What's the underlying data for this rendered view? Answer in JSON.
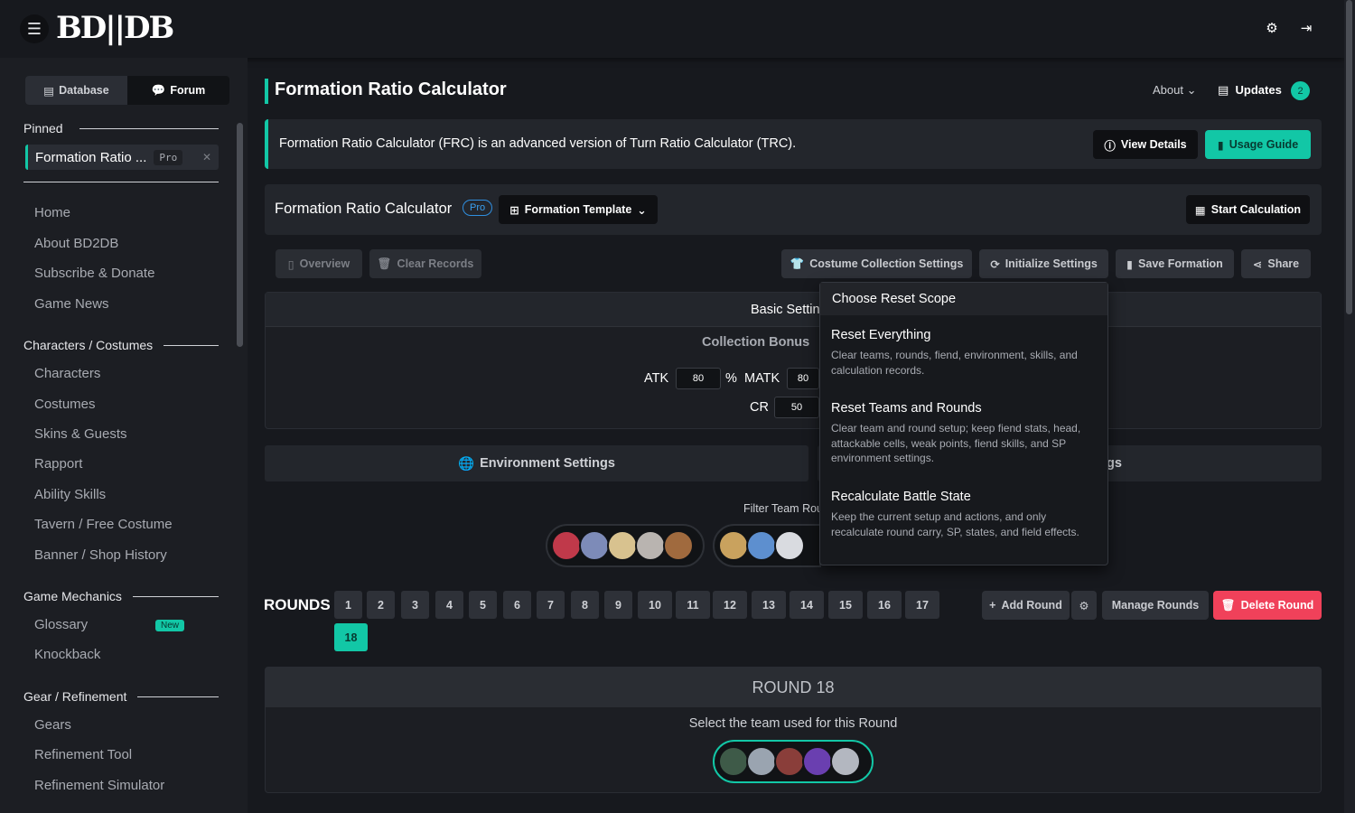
{
  "header": {
    "logo": "BD||DB",
    "menu_icon": "hamburger-icon",
    "settings_icon": "gear-icon",
    "login_icon": "sign-in-icon"
  },
  "sidebar": {
    "tabs": [
      {
        "label": "Database",
        "icon": "database-icon"
      },
      {
        "label": "Forum",
        "icon": "comments-icon"
      }
    ],
    "pinned_title": "Pinned",
    "pinned_item": {
      "label": "Formation Ratio ...",
      "badge": "Pro"
    },
    "items_top": [
      "Home",
      "About BD2DB",
      "Subscribe & Donate",
      "Game News"
    ],
    "sections": [
      {
        "title": "Characters / Costumes",
        "items": [
          "Characters",
          "Costumes",
          "Skins & Guests",
          "Rapport",
          "Ability Skills",
          "Tavern / Free Costume",
          "Banner / Shop History"
        ]
      },
      {
        "title": "Game Mechanics",
        "items": [
          "Glossary",
          "Knockback"
        ],
        "badge": "New"
      },
      {
        "title": "Gear / Refinement",
        "items": [
          "Gears",
          "Refinement Tool",
          "Refinement Simulator"
        ]
      }
    ]
  },
  "page": {
    "title": "Formation Ratio Calculator",
    "about": "About",
    "updates": "Updates",
    "updates_count": "2",
    "banner_text": "Formation Ratio Calculator (FRC) is an advanced version of Turn Ratio Calculator (TRC).",
    "view_details": "View Details",
    "usage_guide": "Usage Guide"
  },
  "calc": {
    "title": "Formation Ratio Calculator",
    "badge": "Pro",
    "template": "Formation Template",
    "start": "Start Calculation",
    "overview": "Overview",
    "clear": "Clear Records",
    "costume": "Costume Collection Settings",
    "init": "Initialize Settings",
    "save": "Save Formation",
    "share": "Share"
  },
  "basic": {
    "header": "Basic Settin",
    "collection": "Collection Bonus",
    "atk_label": "ATK",
    "atk": "80",
    "pct": "%",
    "matk_label": "MATK",
    "matk": "80",
    "cr_label": "CR",
    "cr": "50"
  },
  "env": {
    "left": "Environment Settings",
    "right_fragment": "gs"
  },
  "filter_label": "Filter Team Rou",
  "rounds": {
    "label": "ROUNDS",
    "numbers": [
      "1",
      "2",
      "3",
      "4",
      "5",
      "6",
      "7",
      "8",
      "9",
      "10",
      "11",
      "12",
      "13",
      "14",
      "15",
      "16",
      "17",
      "18"
    ],
    "selected": "18",
    "add": "Add Round",
    "manage": "Manage Rounds",
    "delete": "Delete Round"
  },
  "round18": {
    "title": "ROUND 18",
    "subtitle": "Select the team used for this Round"
  },
  "reset_menu": {
    "title": "Choose Reset Scope",
    "options": [
      {
        "title": "Reset Everything",
        "desc": "Clear teams, rounds, fiend, environment, skills, and calculation records."
      },
      {
        "title": "Reset Teams and Rounds",
        "desc": "Clear team and round setup; keep fiend stats, head, attackable cells, weak points, fiend skills, and SP environment settings."
      },
      {
        "title": "Recalculate Battle State",
        "desc": "Keep the current setup and actions, and only recalculate round carry, SP, states, and field effects."
      }
    ]
  },
  "colors": {
    "accent": "#12c7a6",
    "danger": "#f0415a",
    "bg": "#17191e"
  }
}
